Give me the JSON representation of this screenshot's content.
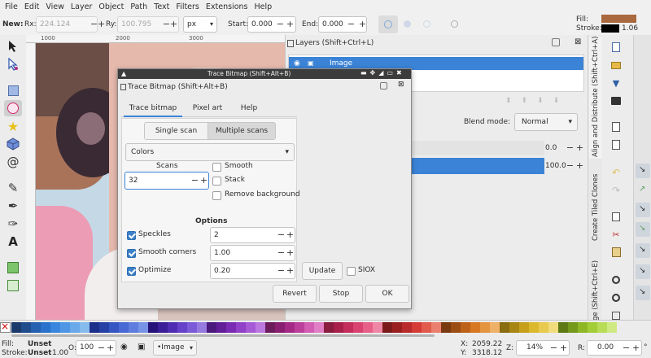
{
  "menubar": {
    "items": [
      "File",
      "Edit",
      "View",
      "Layer",
      "Object",
      "Path",
      "Text",
      "Filters",
      "Extensions",
      "Help"
    ]
  },
  "controls": {
    "tool_label": "New:",
    "rx_label": "Rx:",
    "rx_value": "224.124",
    "ry_label": "Ry:",
    "ry_value": "100.795",
    "unit": "px",
    "start_label": "Start:",
    "start_value": "0.000",
    "end_label": "End:",
    "end_value": "0.000"
  },
  "style_indicator": {
    "fill_label": "Fill:",
    "stroke_label": "Stroke:",
    "stroke_width": "1.06",
    "fill_color": "#a9683e",
    "stroke_color": "#000000"
  },
  "ruler": {
    "labels": [
      "1000",
      "2000",
      "3000"
    ]
  },
  "layers_panel": {
    "title": "Layers (Shift+Ctrl+L)",
    "row_label": "Image"
  },
  "objects_panel": {
    "blend_label": "Blend mode:",
    "blend_value": "Normal",
    "value1": "0.0",
    "value2": "100.0"
  },
  "right_tabs": {
    "align": "Align and Distribute (Shift+Ctrl+A)",
    "tiled": "Create Tiled Clones",
    "image": "Image (Shift+Ctrl+E)"
  },
  "trace_window": {
    "window_title": "Trace Bitmap (Shift+Alt+B)",
    "dialog_title": "Trace Bitmap (Shift+Alt+B)",
    "tabs": [
      "Trace bitmap",
      "Pixel art",
      "Help"
    ],
    "scan_modes": [
      "Single scan",
      "Multiple scans"
    ],
    "mode_value": "Colors",
    "scans_label": "Scans",
    "scans_value": "32",
    "smooth_label": "Smooth",
    "stack_label": "Stack",
    "remove_bg_label": "Remove background",
    "options_title": "Options",
    "speckles_label": "Speckles",
    "speckles_value": "2",
    "smooth_corners_label": "Smooth corners",
    "smooth_corners_value": "1.00",
    "optimize_label": "Optimize",
    "optimize_value": "0.20",
    "update_label": "Update",
    "siox_label": "SIOX",
    "revert_label": "Revert",
    "stop_label": "Stop",
    "ok_label": "OK"
  },
  "palette": {
    "colors": [
      "#1b3a6b",
      "#1f4d8c",
      "#2561b0",
      "#2a72cc",
      "#3a86de",
      "#4f97e6",
      "#6aa9ea",
      "#86bbee",
      "#1c2f8a",
      "#2740a6",
      "#3556c2",
      "#4868d4",
      "#5e7ddf",
      "#7894e6",
      "#26137a",
      "#3a1e97",
      "#4f2db3",
      "#6542c9",
      "#7b5bd7",
      "#957ae0",
      "#4b1a7d",
      "#621f98",
      "#7a2bb3",
      "#9140c8",
      "#a65ad6",
      "#bb79e0",
      "#6d1c5b",
      "#891f70",
      "#a42a86",
      "#bd3f9c",
      "#d25db2",
      "#e17fc6",
      "#8a1c3f",
      "#a8214a",
      "#c32e5b",
      "#d8436f",
      "#e66088",
      "#ef86a5",
      "#7a1a1a",
      "#9a1f1f",
      "#b92a2a",
      "#d43c35",
      "#e25b4d",
      "#ec8070",
      "#7a3a10",
      "#9c4d14",
      "#bd6119",
      "#d87823",
      "#e59440",
      "#efb068",
      "#8a6d10",
      "#a88614",
      "#c6a01b",
      "#dcb82c",
      "#e8ca4e",
      "#f1dc7d",
      "#5d7a14",
      "#75991b",
      "#8db725",
      "#a3cd37",
      "#b9dc58",
      "#cfe983"
    ]
  },
  "statusbar": {
    "fill_label": "Fill:",
    "fill_value": "Unset",
    "stroke_label": "Stroke:",
    "stroke_value": "Unset",
    "stroke_width": "1.00",
    "opacity_label": "O:",
    "opacity_value": "100",
    "layer_value": "•Image",
    "x_label": "X:",
    "x_value": "2059.22",
    "y_label": "Y:",
    "y_value": "3318.12",
    "zoom_label": "Z:",
    "zoom_value": "14%",
    "rotation_label": "R:",
    "rotation_value": "0.00",
    "deg": "°"
  }
}
